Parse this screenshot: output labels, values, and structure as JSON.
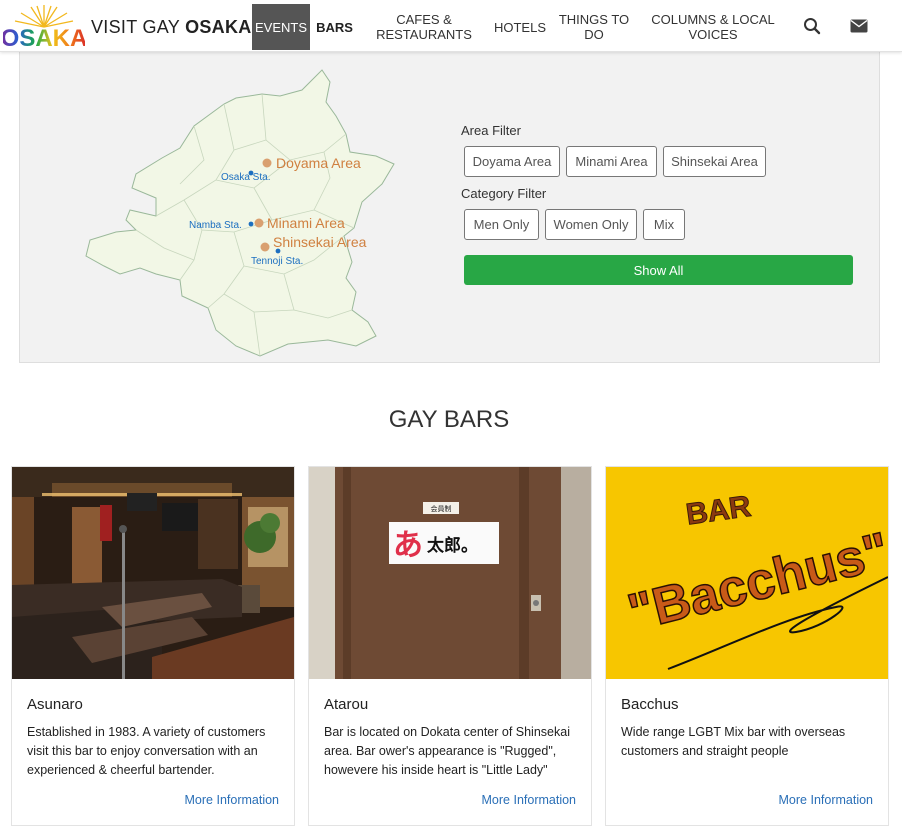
{
  "brand": {
    "logo_text": "OSAKA",
    "prefix": "VISIT GAY",
    "name": "OSAKA"
  },
  "nav": {
    "items": [
      {
        "label": "EVENTS",
        "active": true
      },
      {
        "label": "BARS",
        "bold": true
      },
      {
        "label": "CAFES & RESTAURANTS"
      },
      {
        "label": "HOTELS"
      },
      {
        "label": "THINGS TO DO"
      },
      {
        "label": "COLUMNS & LOCAL VOICES"
      }
    ],
    "icons": [
      "search-icon",
      "envelope-icon"
    ]
  },
  "map": {
    "areas": [
      "Doyama Area",
      "Minami Area",
      "Shinsekai Area"
    ],
    "stations": [
      "Osaka Sta.",
      "Namba Sta.",
      "Tennoji Sta."
    ],
    "area_color": "#d9a070",
    "station_color": "#1c6fc0"
  },
  "filters": {
    "area_label": "Area Filter",
    "area_buttons": [
      "Doyama Area",
      "Minami Area",
      "Shinsekai Area"
    ],
    "category_label": "Category Filter",
    "category_buttons": [
      "Men Only",
      "Women Only",
      "Mix"
    ],
    "show_all": "Show All"
  },
  "section": {
    "title": "GAY BARS"
  },
  "cards": [
    {
      "title": "Asunaro",
      "text": "Established in 1983. A variety of customers visit this bar to enjoy conversation with an experienced & cheerful bartender.",
      "link": "More Information"
    },
    {
      "title": "Atarou",
      "text": "Bar is located on Dokata center of Shinsekai area. Bar ower's appearance is \"Rugged\", howevere his inside heart is \"Little Lady\"",
      "link": "More Information",
      "sign_small": "会員制",
      "sign_main": "あ太郎。"
    },
    {
      "title": "Bacchus",
      "text": "Wide range LGBT Mix bar with overseas customers and straight people",
      "link": "More Information",
      "sign_bar": "BAR",
      "sign_name": "\"Bacchus\""
    }
  ],
  "colors": {
    "accent_green": "#28a745",
    "link_blue": "#2a6fb7",
    "active_nav": "#555555"
  }
}
